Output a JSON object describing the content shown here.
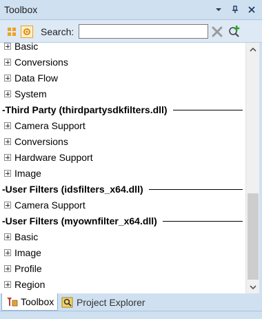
{
  "window": {
    "title": "Toolbox"
  },
  "toolbar": {
    "search_label": "Search:",
    "search_value": "",
    "search_placeholder": ""
  },
  "tree": {
    "rows": [
      {
        "kind": "item",
        "label": "Basic"
      },
      {
        "kind": "item",
        "label": "Conversions"
      },
      {
        "kind": "item",
        "label": "Data Flow"
      },
      {
        "kind": "item",
        "label": "System"
      },
      {
        "kind": "group",
        "label": "-Third Party (thirdpartysdkfilters.dll)"
      },
      {
        "kind": "item",
        "label": "Camera Support"
      },
      {
        "kind": "item",
        "label": "Conversions"
      },
      {
        "kind": "item",
        "label": "Hardware Support"
      },
      {
        "kind": "item",
        "label": "Image"
      },
      {
        "kind": "group",
        "label": "-User Filters (idsfilters_x64.dll)"
      },
      {
        "kind": "item",
        "label": "Camera Support"
      },
      {
        "kind": "group",
        "label": "-User Filters (myownfilter_x64.dll)"
      },
      {
        "kind": "item",
        "label": "Basic"
      },
      {
        "kind": "item",
        "label": "Image"
      },
      {
        "kind": "item",
        "label": "Profile"
      },
      {
        "kind": "item",
        "label": "Region"
      }
    ]
  },
  "tabs": [
    {
      "label": "Toolbox",
      "active": true,
      "icon": "toolbox-icon"
    },
    {
      "label": "Project Explorer",
      "active": false,
      "icon": "project-explorer-icon"
    }
  ],
  "colors": {
    "chrome": "#cfe0f1",
    "toolbar": "#dde9f5",
    "active_highlight": "#e4a32a"
  }
}
